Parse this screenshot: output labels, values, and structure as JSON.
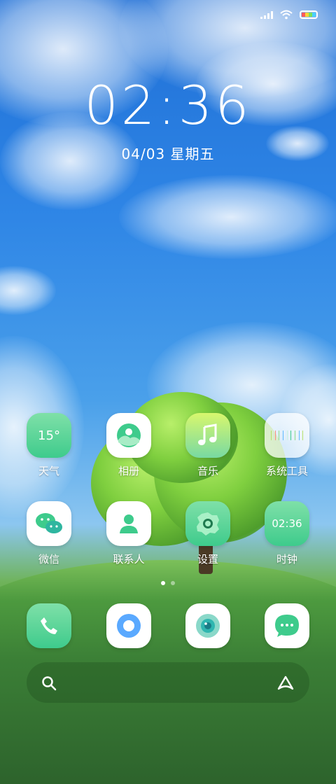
{
  "status_bar": {
    "signal_icon": "signal-icon",
    "wifi_icon": "wifi-icon",
    "battery_icon": "battery-icon"
  },
  "lock": {
    "time": "02:36",
    "date": "04/03 星期五"
  },
  "home_apps": [
    {
      "label": "天气",
      "icon": "weather-icon",
      "icon_text": "15°"
    },
    {
      "label": "相册",
      "icon": "gallery-icon"
    },
    {
      "label": "音乐",
      "icon": "music-icon"
    },
    {
      "label": "系统工具",
      "icon": "folder-icon"
    },
    {
      "label": "微信",
      "icon": "wechat-icon"
    },
    {
      "label": "联系人",
      "icon": "contacts-icon"
    },
    {
      "label": "设置",
      "icon": "settings-icon"
    },
    {
      "label": "时钟",
      "icon": "clock-icon",
      "icon_text": "02:36"
    }
  ],
  "pager": {
    "pages": 2,
    "current": 1
  },
  "dock": [
    {
      "name": "phone",
      "icon": "phone-icon"
    },
    {
      "name": "browser",
      "icon": "browser-icon"
    },
    {
      "name": "camera",
      "icon": "camera-icon"
    },
    {
      "name": "messages",
      "icon": "messages-icon"
    }
  ],
  "bottom_bar": {
    "search_icon": "search-icon",
    "assistant_icon": "assistant-icon"
  },
  "colors": {
    "accent_green": "#3ecb8c",
    "sky_blue": "#2f86e6"
  }
}
